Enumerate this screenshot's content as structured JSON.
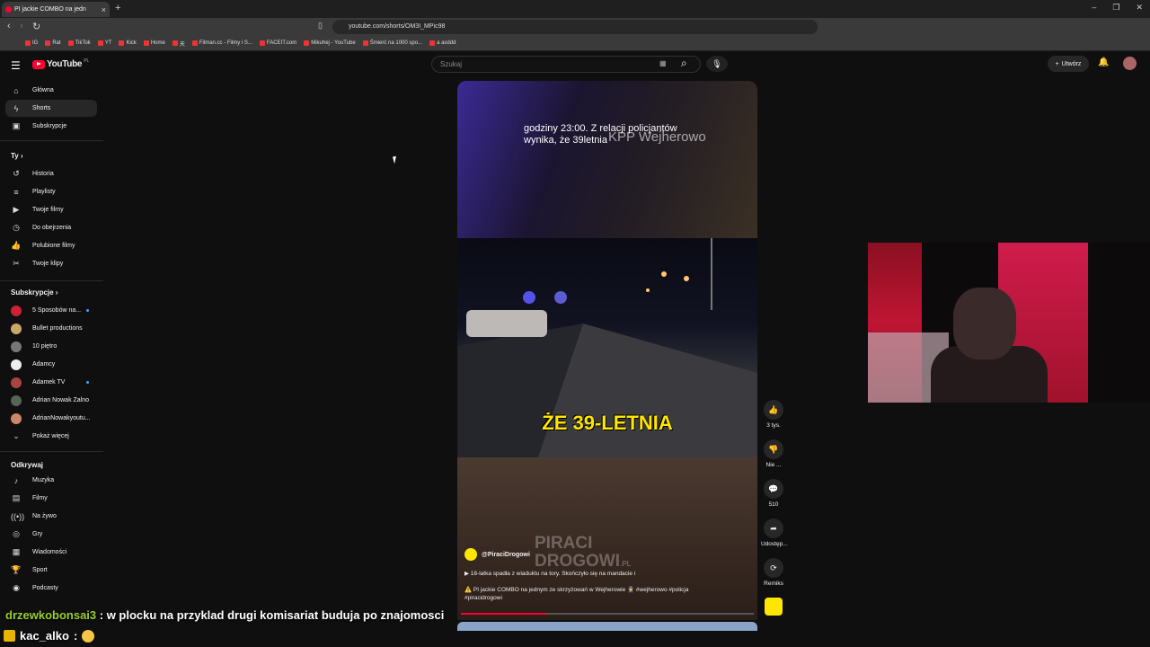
{
  "browser": {
    "tab_title": "PI jackie COMBO na jedn",
    "tab_close": "×",
    "new_tab": "+",
    "url": "youtube.com/shorts/OM3I_MPic98",
    "bookmarks": [
      "IG",
      "Rat",
      "TikTok",
      "YT",
      "Kick",
      "Home",
      "天",
      "Filman.cc - Filmy i S...",
      "FACEIT.com",
      "Mikuhej - YouTube",
      "Śmierć na 1000 spo...",
      "a asddd"
    ]
  },
  "youtube": {
    "logo_text": "YouTube",
    "logo_region": "PL",
    "search_placeholder": "Szukaj",
    "create_label": "Utwórz"
  },
  "sidebar": {
    "main": [
      {
        "label": "Główna",
        "icon": "home-icon"
      },
      {
        "label": "Shorts",
        "icon": "shorts-icon",
        "active": true
      },
      {
        "label": "Subskrypcje",
        "icon": "subscriptions-icon"
      }
    ],
    "you_header": "Ty",
    "you": [
      {
        "label": "Historia",
        "icon": "history-icon"
      },
      {
        "label": "Playlisty",
        "icon": "playlist-icon"
      },
      {
        "label": "Twoje filmy",
        "icon": "video-icon"
      },
      {
        "label": "Do obejrzenia",
        "icon": "clock-icon"
      },
      {
        "label": "Polubione filmy",
        "icon": "like-icon"
      },
      {
        "label": "Twoje klipy",
        "icon": "scissors-icon"
      }
    ],
    "subs_header": "Subskrypcje",
    "subs": [
      {
        "label": "5 Sposobów na...",
        "color": "#c23",
        "live": true
      },
      {
        "label": "Bullet productions",
        "color": "#caa86a",
        "live": false
      },
      {
        "label": "10 piętro",
        "color": "#777",
        "live": false
      },
      {
        "label": "Adamcy",
        "color": "#eee",
        "live": false
      },
      {
        "label": "Adamek TV",
        "color": "#a44",
        "live": true
      },
      {
        "label": "Adrian Nowak Zalno",
        "color": "#565",
        "live": false
      },
      {
        "label": "AdrianNowakyoutu...",
        "color": "#c86",
        "live": false
      }
    ],
    "show_more": "Pokaż więcej",
    "explore_header": "Odkrywaj",
    "explore": [
      {
        "label": "Muzyka",
        "icon": "music-icon"
      },
      {
        "label": "Filmy",
        "icon": "film-icon"
      },
      {
        "label": "Na żywo",
        "icon": "live-icon"
      },
      {
        "label": "Gry",
        "icon": "gamepad-icon"
      },
      {
        "label": "Wiadomości",
        "icon": "news-icon"
      },
      {
        "label": "Sport",
        "icon": "trophy-icon"
      },
      {
        "label": "Podcasty",
        "icon": "podcast-icon"
      }
    ]
  },
  "short": {
    "caption_top": "godziny 23:00. Z relacji policjantów wynika, że 39letnia",
    "caption_overlay": "KPP Wejherowo",
    "big_caption": "ŻE 39-LETNIA",
    "watermark_line1": "PIRACI",
    "watermark_line2": "DROGOWI",
    "watermark_suffix": ".PL",
    "channel": "@PiraciDrogowi",
    "playlist_line": "▶  18-latka spadła z wiaduktu na tory. Skończyło się na mandacie i",
    "description": "⚠️ PI jackie COMBO na jednym ze skrzyżowań w Wejherowie 👮 #wejherowo #policja #piracidrogowi",
    "progress": 0.29,
    "likes": "3 tys.",
    "dislike_label": "Nie ...",
    "comments": "510",
    "share_label": "Udostęp...",
    "remix_label": "Remiks"
  },
  "chat": {
    "msg1_user": "drzewkobonsai3",
    "msg1_text": ": w plocku na przyklad drugi komisariat buduja po znajomosci",
    "msg2_user": "kac_alko",
    "msg2_text": ":"
  },
  "colors": {
    "accent": "#ff0033",
    "caption": "#ffe600",
    "link": "#3ea6ff"
  }
}
